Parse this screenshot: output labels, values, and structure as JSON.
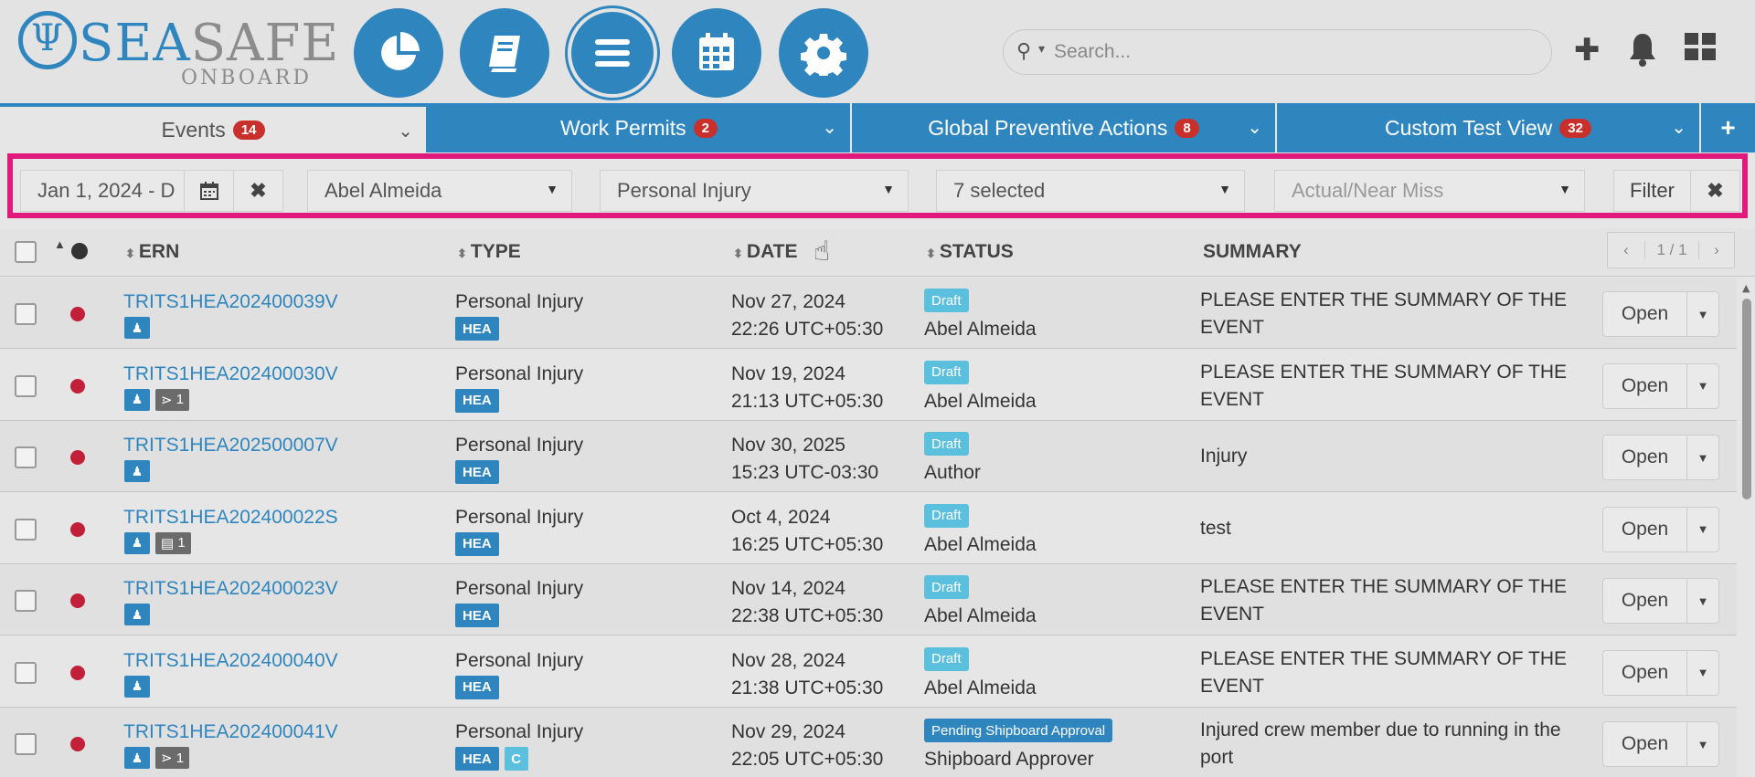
{
  "app": {
    "logo": {
      "part1": "SEA",
      "part2": "SAFE",
      "sub": "ONBOARD"
    },
    "nav_icons": [
      "pie-chart-icon",
      "book-icon",
      "menu-icon",
      "calendar-icon",
      "gear-icon"
    ],
    "search": {
      "placeholder": "Search..."
    },
    "header_icons": [
      "plus-icon",
      "bell-icon",
      "grid-icon"
    ]
  },
  "tabs": [
    {
      "label": "Events",
      "count": "14"
    },
    {
      "label": "Work Permits",
      "count": "2"
    },
    {
      "label": "Global Preventive Actions",
      "count": "8"
    },
    {
      "label": "Custom Test View",
      "count": "32"
    }
  ],
  "filters": {
    "date_range": "Jan 1, 2024 - D",
    "person": "Abel Almeida",
    "type": "Personal Injury",
    "status": "7 selected",
    "actual_near_miss_placeholder": "Actual/Near Miss",
    "filter_button": "Filter"
  },
  "table": {
    "columns": {
      "ern": "ERN",
      "type": "TYPE",
      "date": "DATE",
      "status": "STATUS",
      "summary": "SUMMARY"
    },
    "pager": "1 / 1",
    "open_label": "Open",
    "rows": [
      {
        "ern": "TRITS1HEA202400039V",
        "count_tag": "",
        "type": "Personal Injury",
        "date": "Nov 27, 2024",
        "time": "22:26 UTC+05:30",
        "status": "Draft",
        "user": "Abel Almeida",
        "summary": "PLEASE ENTER THE SUMMARY OF THE EVENT"
      },
      {
        "ern": "TRITS1HEA202400030V",
        "count_tag": "1",
        "type": "Personal Injury",
        "date": "Nov 19, 2024",
        "time": "21:13 UTC+05:30",
        "status": "Draft",
        "user": "Abel Almeida",
        "summary": "PLEASE ENTER THE SUMMARY OF THE EVENT"
      },
      {
        "ern": "TRITS1HEA202500007V",
        "count_tag": "",
        "type": "Personal Injury",
        "date": "Nov 30, 2025",
        "time": "15:23 UTC-03:30",
        "status": "Draft",
        "user": "Author",
        "summary": "Injury"
      },
      {
        "ern": "TRITS1HEA202400022S",
        "count_tag": "1",
        "type": "Personal Injury",
        "date": "Oct 4, 2024",
        "time": "16:25 UTC+05:30",
        "status": "Draft",
        "user": "Abel Almeida",
        "summary": "test"
      },
      {
        "ern": "TRITS1HEA202400023V",
        "count_tag": "",
        "type": "Personal Injury",
        "date": "Nov 14, 2024",
        "time": "22:38 UTC+05:30",
        "status": "Draft",
        "user": "Abel Almeida",
        "summary": "PLEASE ENTER THE SUMMARY OF THE EVENT"
      },
      {
        "ern": "TRITS1HEA202400040V",
        "count_tag": "",
        "type": "Personal Injury",
        "date": "Nov 28, 2024",
        "time": "21:38 UTC+05:30",
        "status": "Draft",
        "user": "Abel Almeida",
        "summary": "PLEASE ENTER THE SUMMARY OF THE EVENT"
      },
      {
        "ern": "TRITS1HEA202400041V",
        "count_tag": "1",
        "type": "Personal Injury",
        "date": "Nov 29, 2024",
        "time": "22:05 UTC+05:30",
        "status": "Pending Shipboard Approval",
        "user": "Shipboard Approver",
        "summary": "Injured crew member due to running in the port"
      }
    ],
    "type_tag": "HEA",
    "extra_type_tag": "C"
  },
  "colors": {
    "brand": "#2f86bf",
    "badge": "#c9302c",
    "highlight": "#e0197a",
    "dot": "#c21f39",
    "draft": "#5bc0de"
  }
}
